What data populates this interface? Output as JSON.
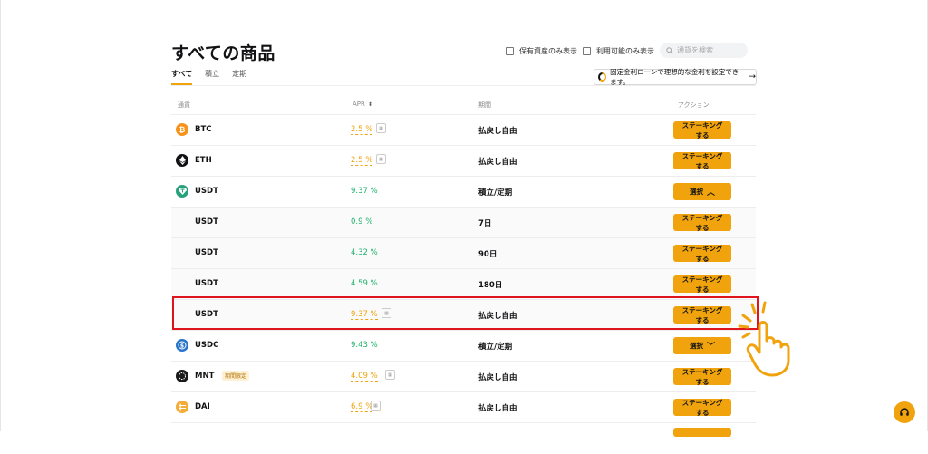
{
  "page": {
    "title": "すべての商品"
  },
  "filters": [
    {
      "label": "保有資産のみ表示"
    },
    {
      "label": "利用可能のみ表示"
    }
  ],
  "search": {
    "placeholder": "通貨を検索"
  },
  "tabs": [
    {
      "label": "すべて",
      "active": true
    },
    {
      "label": "積立",
      "active": false
    },
    {
      "label": "定期",
      "active": false
    }
  ],
  "promo": {
    "text": "固定金利ローンで理想的な金利を設定できます。",
    "arrow": "→"
  },
  "table": {
    "headers": {
      "coin": "通貨",
      "apr": "APR",
      "period": "期間",
      "action": "アクション"
    },
    "rows": [
      {
        "coin": "BTC",
        "apr": "2.5 %",
        "period": "払戻し自由",
        "action": "ステーキングする"
      },
      {
        "coin": "ETH",
        "apr": "2.5 %",
        "period": "払戻し自由",
        "action": "ステーキングする"
      },
      {
        "coin": "USDT",
        "apr": "9.37 %",
        "period": "積立/定期",
        "action": "選択",
        "chevron": "^"
      },
      {
        "coin": "USDT",
        "apr": "0.9 %",
        "period": "7日",
        "action": "ステーキングする"
      },
      {
        "coin": "USDT",
        "apr": "4.32 %",
        "period": "90日",
        "action": "ステーキングする"
      },
      {
        "coin": "USDT",
        "apr": "4.59 %",
        "period": "180日",
        "action": "ステーキングする"
      },
      {
        "coin": "USDT",
        "apr": "9.37 %",
        "period": "払戻し自由",
        "action": "ステーキングする"
      },
      {
        "coin": "USDC",
        "apr": "9.43 %",
        "period": "積立/定期",
        "action": "選択",
        "chevron": "v"
      },
      {
        "coin": "MNT",
        "badge": "期間限定",
        "apr": "4.09 %",
        "period": "払戻し自由",
        "action": "ステーキングする"
      },
      {
        "coin": "DAI",
        "apr": "6.9 %",
        "period": "払戻し自由",
        "action": "ステーキングする"
      }
    ]
  },
  "colors": {
    "accent": "#f0a30c",
    "green": "#20b26c",
    "highlight": "#e0141e",
    "btc": "#f7931a",
    "eth": "#121214",
    "usdt": "#26a17b",
    "usdc": "#2775ca",
    "mnt": "#1a1a1a",
    "dai": "#f5ac37"
  }
}
